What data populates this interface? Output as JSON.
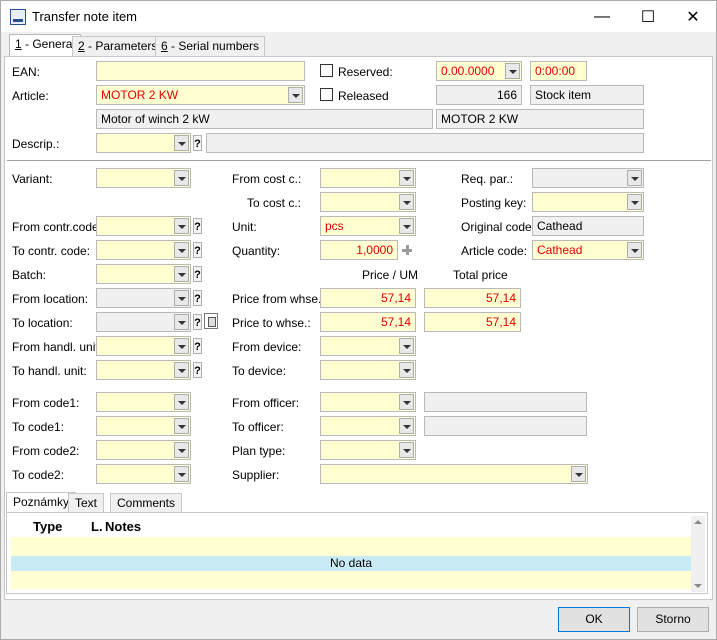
{
  "window": {
    "title": "Transfer note item"
  },
  "tabs": [
    {
      "key": "1",
      "label": " - General"
    },
    {
      "key": "2",
      "label": " - Parameters"
    },
    {
      "key": "6",
      "label": " - Serial numbers"
    }
  ],
  "form": {
    "ean_label": "EAN:",
    "reserved_label": "Reserved:",
    "released_label": "Released",
    "reserved_qty": "0.00.0000",
    "reserved_time": "0:00:00",
    "article_label": "Article:",
    "article_value": "MOTOR 2 KW",
    "released_count": "166",
    "stock_item": "Stock item",
    "article_name": "Motor of winch 2 kW",
    "article_code_display": "MOTOR 2 KW",
    "descrip_label": "Descrip.:",
    "variant_label": "Variant:",
    "from_cost_label": "From cost c.:",
    "to_cost_label": "To cost c.:",
    "req_par_label": "Req. par.:",
    "posting_key_label": "Posting key:",
    "from_contr_label": "From contr.code:",
    "to_contr_label": "To contr. code:",
    "unit_label": "Unit:",
    "unit_value": "pcs",
    "original_code_label": "Original code:",
    "original_code_value": "Cathead",
    "quantity_label": "Quantity:",
    "quantity_value": "1,0000",
    "article_code_label": "Article code:",
    "article_code_value": "Cathead",
    "batch_label": "Batch:",
    "price_um_header": "Price / UM",
    "total_price_header": "Total price",
    "from_location_label": "From location:",
    "to_location_label": "To location:",
    "price_from_label": "Price from whse.:",
    "price_from_um": "57,14",
    "price_from_total": "57,14",
    "price_to_label": "Price to whse.:",
    "price_to_um": "57,14",
    "price_to_total": "57,14",
    "from_handl_label": "From handl. unit:",
    "to_handl_label": "To handl. unit:",
    "from_device_label": "From device:",
    "to_device_label": "To device:",
    "from_code1_label": "From code1:",
    "to_code1_label": "To code1:",
    "from_code2_label": "From code2:",
    "to_code2_label": "To code2:",
    "from_officer_label": "From officer:",
    "to_officer_label": "To officer:",
    "plan_type_label": "Plan type:",
    "supplier_label": "Supplier:",
    "question_mark": "?"
  },
  "bottom_tabs": [
    "Poznámky",
    "Text",
    "Comments"
  ],
  "grid": {
    "columns": [
      "Type",
      "L.",
      "Notes"
    ],
    "empty_text": "No data"
  },
  "buttons": {
    "ok": "OK",
    "cancel": "Storno"
  },
  "window_controls": {
    "minimize": "—",
    "maximize": "☐",
    "close": "✕"
  }
}
